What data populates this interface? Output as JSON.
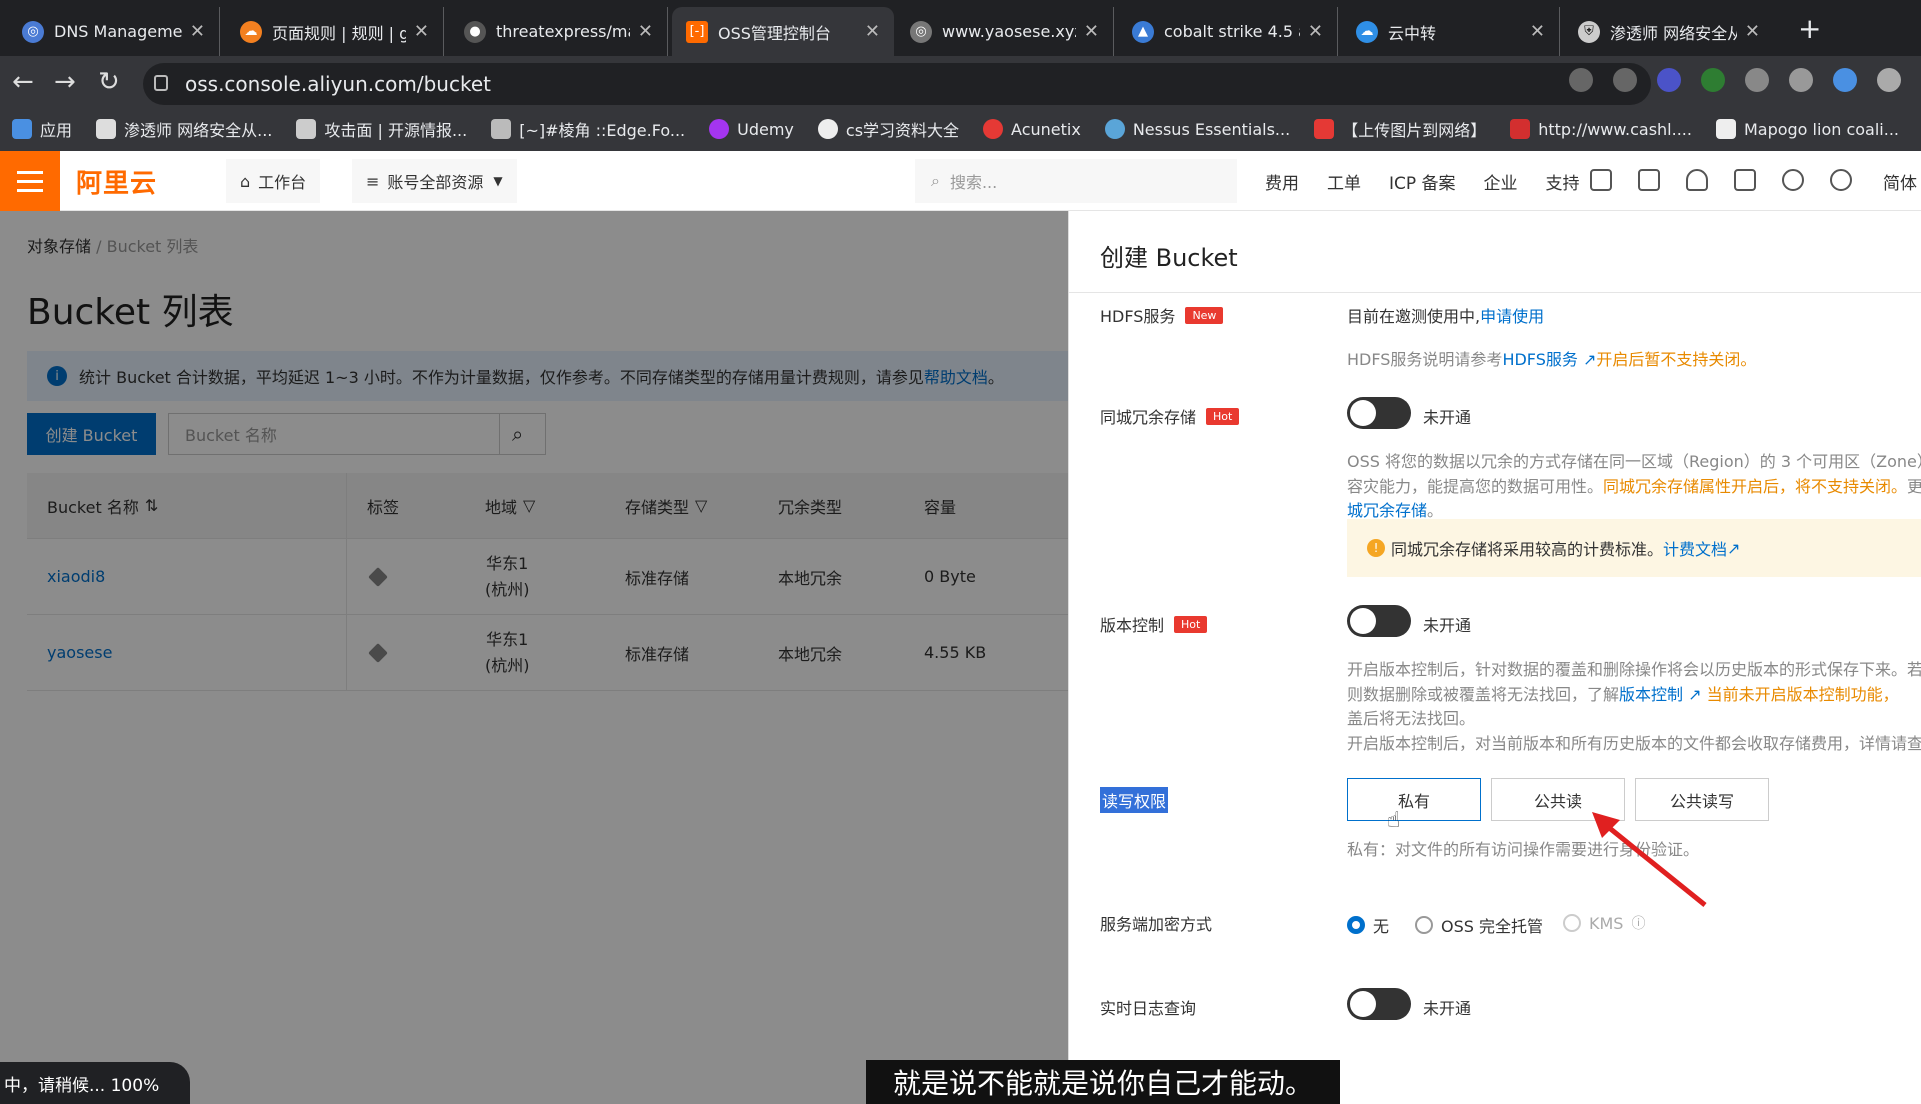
{
  "browser": {
    "tabs": [
      {
        "title": "DNS Managemen",
        "icon": "globe-icon",
        "color": "#4a7bd4"
      },
      {
        "title": "页面规则 | 规则 | g",
        "icon": "cloud-icon",
        "color": "#f38020"
      },
      {
        "title": "threatexpress/ma",
        "icon": "github-icon",
        "color": "#555"
      },
      {
        "title": "OSS管理控制台",
        "icon": "aliyun-icon",
        "color": "#ff6a00",
        "active": true
      },
      {
        "title": "www.yaosese.xyz",
        "icon": "globe-icon",
        "color": "#777"
      },
      {
        "title": "cobalt strike 4.5 ä",
        "icon": "cobalt-icon",
        "color": "#3a7bd5"
      },
      {
        "title": "云中转",
        "icon": "cloud-icon",
        "color": "#2f8fe6"
      },
      {
        "title": "渗透师 网络安全从",
        "icon": "shield-icon",
        "color": "#ccc"
      }
    ],
    "url": "oss.console.aliyun.com/bucket",
    "bookmarks": [
      "应用",
      "渗透师 网络安全从...",
      "攻击面 | 开源情报...",
      "[~]#棱角 ::Edge.Fo...",
      "Udemy",
      "cs学习资料大全",
      "Acunetix",
      "Nessus Essentials...",
      "【上传图片到网络】",
      "http://www.cashl....",
      "Mapogo lion coali..."
    ]
  },
  "header": {
    "logo": "阿里云",
    "workbench": "工作台",
    "resources": "账号全部资源",
    "search_placeholder": "搜索...",
    "links": [
      "费用",
      "工单",
      "ICP 备案",
      "企业",
      "支持"
    ],
    "lang": "简体"
  },
  "main": {
    "breadcrumb": [
      "对象存储",
      "Bucket 列表"
    ],
    "title": "Bucket 列表",
    "notice": "统计 Bucket 合计数据，平均延迟 1~3 小时。不作为计量数据，仅作参考。不同存储类型的存储用量计费规则，请参见",
    "notice_link": "帮助文档",
    "notice_end": "。",
    "create_button": "创建 Bucket",
    "search_placeholder": "Bucket 名称",
    "columns": [
      "Bucket 名称",
      "标签",
      "地域",
      "存储类型",
      "冗余类型",
      "容量"
    ],
    "rows": [
      {
        "name": "xiaodi8",
        "region1": "华东1",
        "region2": "(杭州)",
        "storage": "标准存储",
        "redundancy": "本地冗余",
        "capacity": "0 Byte"
      },
      {
        "name": "yaosese",
        "region1": "华东1",
        "region2": "(杭州)",
        "storage": "标准存储",
        "redundancy": "本地冗余",
        "capacity": "4.55 KB"
      }
    ]
  },
  "drawer": {
    "title": "创建 Bucket",
    "hdfs": {
      "label": "HDFS服务",
      "badge": "New",
      "status": "目前在邀测使用中,",
      "apply": "申请使用",
      "desc1": "HDFS服务说明请参考",
      "desc_link": "HDFS服务",
      "desc2": "开启后暂不支持关闭。"
    },
    "zrs": {
      "label": "同城冗余存储",
      "badge": "Hot",
      "state": "未开通",
      "l1": "OSS 将您的数据以冗余的方式存储在同一区域（Region）的 3 个可用区（Zone）",
      "l2a": "容灾能力，能提高您的数据可用性。",
      "l2b": "同城冗余存储属性开启后，将不支持关闭。",
      "l2c": "更",
      "l3": "城冗余存储",
      "l3end": "。",
      "warn": "同城冗余存储将采用较高的计费标准。",
      "warn_link": "计费文档"
    },
    "version": {
      "label": "版本控制",
      "badge": "Hot",
      "state": "未开通",
      "l1": "开启版本控制后，针对数据的覆盖和删除操作将会以历史版本的形式保存下来。若",
      "l2a": "则数据删除或被覆盖将无法找回，了解",
      "l2link": "版本控制",
      "l2b": "当前未开启版本控制功能，",
      "l3": "盖后将无法找回。",
      "l4": "开启版本控制后，对当前版本和所有历史版本的文件都会收取存储费用，详情请查"
    },
    "acl": {
      "label": "读写权限",
      "options": [
        "私有",
        "公共读",
        "公共读写"
      ],
      "desc": "私有：对文件的所有访问操作需要进行身份验证。"
    },
    "encrypt": {
      "label": "服务端加密方式",
      "options": [
        "无",
        "OSS 完全托管",
        "KMS"
      ]
    },
    "log": {
      "label": "实时日志查询",
      "state": "未开通"
    }
  },
  "overlay": {
    "status": "中，请稍候... 100%",
    "subtitle": "就是说不能就是说你自己才能动。"
  }
}
